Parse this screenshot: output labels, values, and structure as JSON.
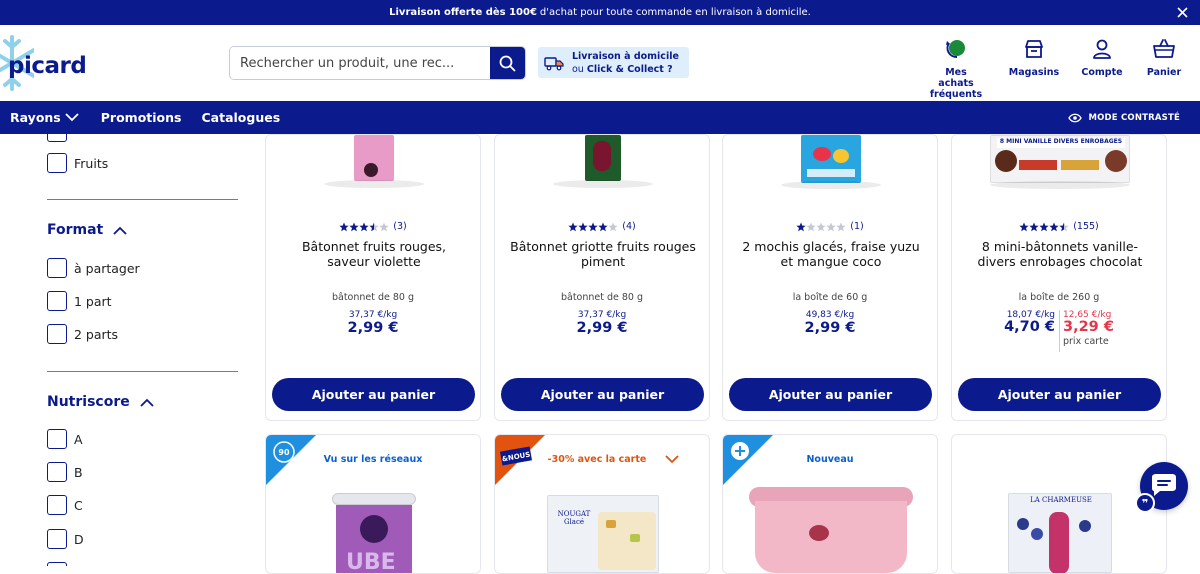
{
  "banner": {
    "bold": "Livraison offerte dès 100€",
    "rest": "d'achat pour toute commande en livraison à domicile."
  },
  "logo": {
    "text": "picard"
  },
  "search": {
    "placeholder": "Rechercher un produit, une rec..."
  },
  "delivery": {
    "line1": "Livraison à domicile",
    "line2_prefix": "ou",
    "line2_bold": "Click & Collect ?"
  },
  "header_nav": {
    "frequent": "Mes achats fréquents",
    "stores": "Magasins",
    "account": "Compte",
    "cart": "Panier"
  },
  "nav": {
    "rayons": "Rayons",
    "promotions": "Promotions",
    "catalogues": "Catalogues",
    "contrast": "MODE CONTRASTÉ"
  },
  "sidebar": {
    "fruits": "Fruits",
    "format_title": "Format",
    "format_options": [
      "à partager",
      "1 part",
      "2 parts"
    ],
    "nutriscore_title": "Nutriscore",
    "nutriscore_options": [
      "A",
      "B",
      "C",
      "D"
    ]
  },
  "products": [
    {
      "rating": 3.5,
      "count": "(3)",
      "name": "Bâtonnet fruits rouges, saveur violette",
      "weight": "bâtonnet de 80 g",
      "perkg": "37,37 €/kg",
      "price": "2,99 €",
      "button": "Ajouter au panier"
    },
    {
      "rating": 4,
      "count": "(4)",
      "name": "Bâtonnet griotte fruits rouges piment",
      "weight": "bâtonnet de 80 g",
      "perkg": "37,37 €/kg",
      "price": "2,99 €",
      "button": "Ajouter au panier"
    },
    {
      "rating": 1,
      "count": "(1)",
      "name": "2 mochis glacés, fraise yuzu et mangue coco",
      "weight": "la boîte de 60 g",
      "perkg": "49,83 €/kg",
      "price": "2,99 €",
      "button": "Ajouter au panier"
    },
    {
      "rating": 4.5,
      "count": "(155)",
      "name": "8 mini-bâtonnets vanille-divers enrobages chocolat",
      "weight": "la boîte de 260 g",
      "perkg": "18,07 €/kg",
      "price": "4,70 €",
      "card_perkg": "12,65 €/kg",
      "card_price": "3,29 €",
      "card_label": "prix carte",
      "button": "Ajouter au panier"
    }
  ],
  "row2": [
    {
      "tag": "Vu sur les réseaux",
      "tag_color": "#0b5fd0"
    },
    {
      "tag": "-30% avec la carte",
      "tag_color": "#e2530f"
    },
    {
      "tag": "Nouveau",
      "tag_color": "#0b5fd0"
    },
    {
      "tag": ""
    }
  ],
  "colors": {
    "brand": "#0b1a8c",
    "promo": "#e2374b",
    "accent_orange": "#e2530f",
    "corner_blue": "#1f8fe0"
  }
}
